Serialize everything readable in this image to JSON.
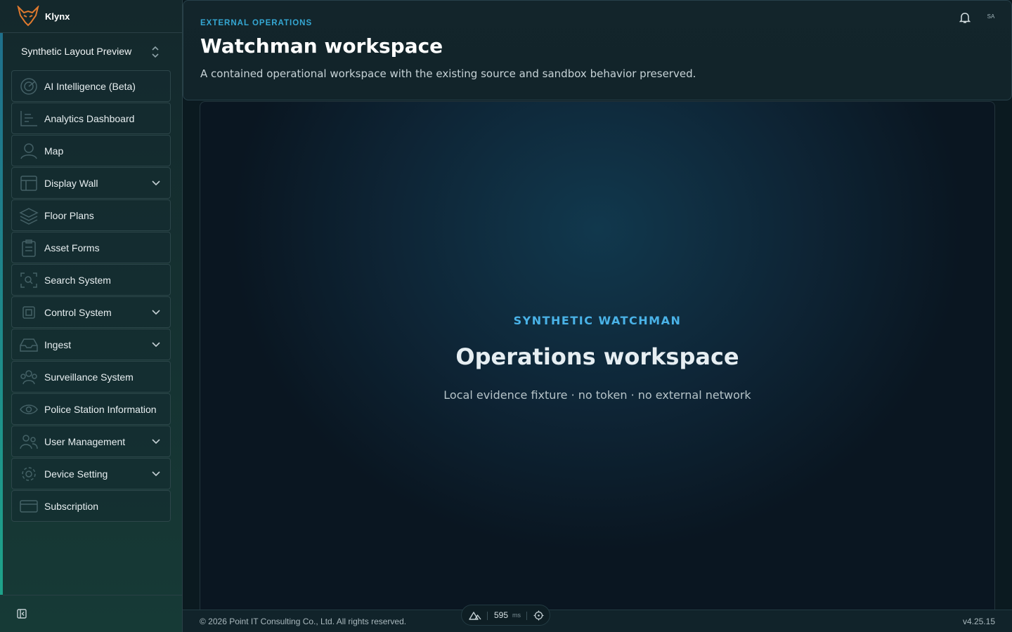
{
  "brand": {
    "name": "Klynx",
    "logo_icon": "fox-logo-icon",
    "logo_color": "#e07a2e"
  },
  "workspace_switcher": {
    "label": "Synthetic Layout Preview",
    "icon": "chevron-up-down-icon"
  },
  "sidebar": {
    "items": [
      {
        "label": "AI Intelligence (Beta)",
        "icon": "radar-icon",
        "expandable": false
      },
      {
        "label": "Analytics Dashboard",
        "icon": "chart-icon",
        "expandable": false
      },
      {
        "label": "Map",
        "icon": "map-pin-icon",
        "expandable": false
      },
      {
        "label": "Display Wall",
        "icon": "layout-icon",
        "expandable": true
      },
      {
        "label": "Floor Plans",
        "icon": "layers-icon",
        "expandable": false
      },
      {
        "label": "Asset Forms",
        "icon": "clipboard-icon",
        "expandable": false
      },
      {
        "label": "Search System",
        "icon": "scan-search-icon",
        "expandable": false
      },
      {
        "label": "Control System",
        "icon": "cpu-icon",
        "expandable": true
      },
      {
        "label": "Ingest",
        "icon": "inbox-icon",
        "expandable": true
      },
      {
        "label": "Surveillance System",
        "icon": "users-icon",
        "expandable": false
      },
      {
        "label": "Police Station Information",
        "icon": "eye-icon",
        "expandable": false
      },
      {
        "label": "User Management",
        "icon": "user-group-icon",
        "expandable": true
      },
      {
        "label": "Device Setting",
        "icon": "gear-icon",
        "expandable": true
      },
      {
        "label": "Subscription",
        "icon": "credit-card-icon",
        "expandable": false
      }
    ],
    "collapse_icon": "sidebar-collapse-icon"
  },
  "header": {
    "eyebrow": "EXTERNAL OPERATIONS",
    "title": "Watchman workspace",
    "description": "A contained operational workspace with the existing source and sandbox behavior preserved.",
    "avatar_initials": "SA",
    "notification_icon": "bell-icon"
  },
  "main": {
    "eyebrow": "SYNTHETIC WATCHMAN",
    "title": "Operations workspace",
    "subtitle": "Local evidence fixture · no token · no external network"
  },
  "footer": {
    "copyright": "© 2026 Point IT Consulting Co., Ltd. All rights reserved.",
    "version": "v4.25.15"
  },
  "perf": {
    "value": "595",
    "unit": "ms",
    "logo_icon": "nuxt-icon",
    "target_icon": "crosshair-icon"
  },
  "colors": {
    "accent": "#35a8d4",
    "sidebar_bg": "#14282c",
    "main_bg": "#0b1a20"
  }
}
